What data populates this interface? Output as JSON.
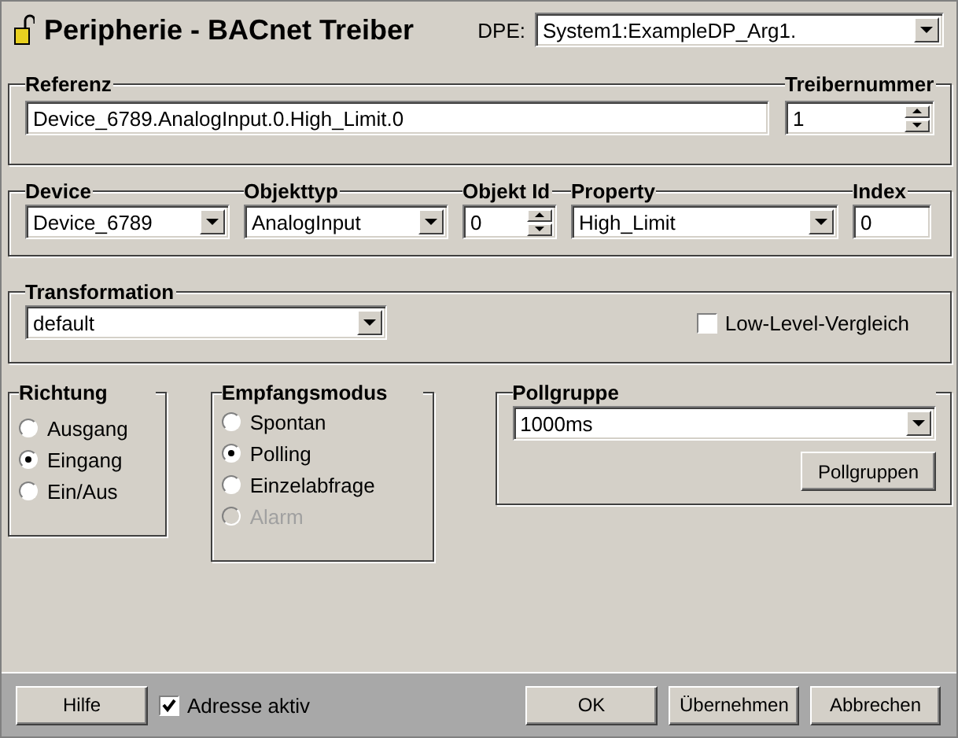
{
  "window": {
    "title": "Peripherie - BACnet Treiber"
  },
  "dpe": {
    "label": "DPE:",
    "value": "System1:ExampleDP_Arg1."
  },
  "reference": {
    "label": "Referenz",
    "value": "Device_6789.AnalogInput.0.High_Limit.0"
  },
  "driver_number": {
    "label": "Treibernummer",
    "value": "1"
  },
  "address_fields": [
    {
      "kind": "combo",
      "label": "Device",
      "value": "Device_6789"
    },
    {
      "kind": "combo",
      "label": "Objekttyp",
      "value": "AnalogInput"
    },
    {
      "kind": "spin",
      "label": "Objekt Id",
      "value": "0"
    },
    {
      "kind": "combo",
      "label": "Property",
      "value": "High_Limit"
    },
    {
      "kind": "text",
      "label": "Index",
      "value": "0"
    }
  ],
  "transformation": {
    "label": "Transformation",
    "value": "default",
    "low_level": {
      "label": "Low-Level-Vergleich",
      "checked": false
    }
  },
  "direction": {
    "label": "Richtung",
    "options": [
      {
        "label": "Ausgang",
        "selected": false,
        "disabled": false
      },
      {
        "label": "Eingang",
        "selected": true,
        "disabled": false
      },
      {
        "label": "Ein/Aus",
        "selected": false,
        "disabled": false
      }
    ]
  },
  "receive_mode": {
    "label": "Empfangsmodus",
    "options": [
      {
        "label": "Spontan",
        "selected": false,
        "disabled": false
      },
      {
        "label": "Polling",
        "selected": true,
        "disabled": false
      },
      {
        "label": "Einzelabfrage",
        "selected": false,
        "disabled": false
      },
      {
        "label": "Alarm",
        "selected": false,
        "disabled": true
      }
    ]
  },
  "poll_group": {
    "label": "Pollgruppe",
    "value": "1000ms",
    "button": "Pollgruppen"
  },
  "footer": {
    "help": "Hilfe",
    "address_active": {
      "label": "Adresse aktiv",
      "checked": true
    },
    "buttons": [
      "OK",
      "Übernehmen",
      "Abbrechen"
    ]
  }
}
